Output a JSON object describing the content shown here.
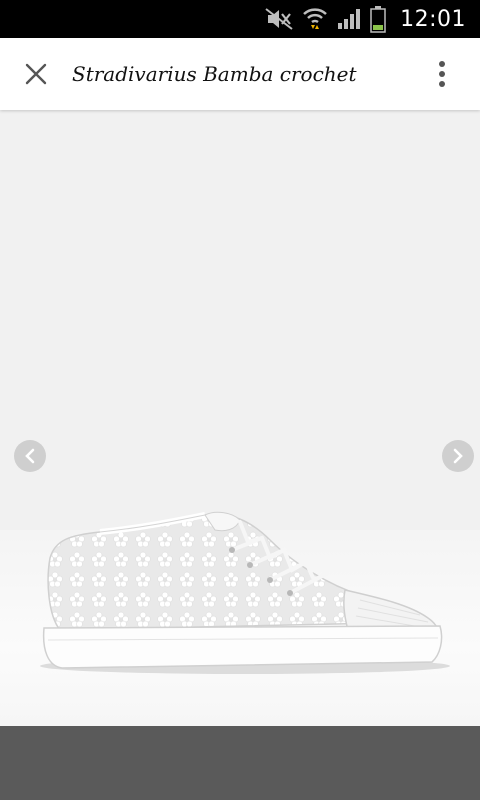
{
  "status_bar": {
    "time": "12:01",
    "icons": [
      "mute-icon",
      "wifi-icon",
      "signal-icon",
      "battery-icon"
    ]
  },
  "app_bar": {
    "title": "Stradivarius Bamba crochet",
    "close_icon": "close-icon",
    "menu_icon": "more-vert-icon"
  },
  "viewer": {
    "prev_icon": "chevron-left-icon",
    "next_icon": "chevron-right-icon",
    "image_subject": "white crochet flower sneaker"
  },
  "colors": {
    "status_bar": "#000000",
    "app_bar": "#ffffff",
    "viewer_bg": "#f1f1f1",
    "bottom_panel": "#5a5a5a",
    "wifi_arrows": "#f0b400",
    "battery": "#8bc34a"
  }
}
